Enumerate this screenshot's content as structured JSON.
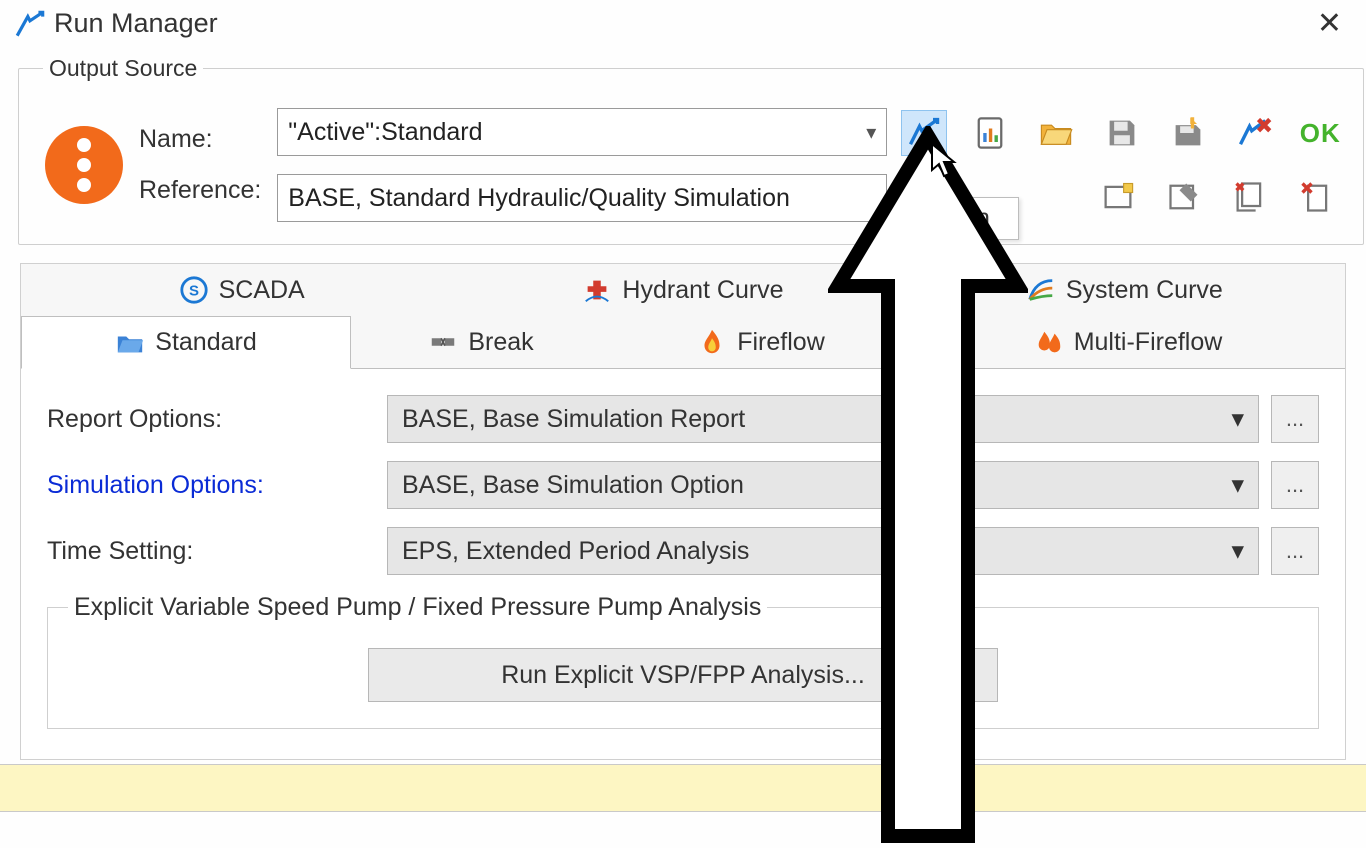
{
  "window": {
    "title": "Run Manager",
    "close_glyph": "✕"
  },
  "output_source": {
    "legend": "Output Source",
    "name_label": "Name:",
    "reference_label": "Reference:",
    "name_value": "\"Active\":Standard",
    "reference_value": "BASE, Standard Hydraulic/Quality Simulation"
  },
  "toolbar": {
    "ok_label": "OK",
    "tooltip": "Run"
  },
  "tabs": {
    "scada": "SCADA",
    "hydrant_curve": "Hydrant Curve",
    "system_curve": "System Curve",
    "standard": "Standard",
    "break": "Break",
    "fireflow": "Fireflow",
    "multi_fireflow": "Multi-Fireflow"
  },
  "standard_tab": {
    "report_options_label": "Report Options:",
    "report_options_value": "BASE, Base Simulation Report",
    "simulation_options_label": "Simulation Options:",
    "simulation_options_value": "BASE, Base Simulation Option",
    "time_setting_label": "Time Setting:",
    "time_setting_value": "EPS, Extended Period Analysis",
    "vsp_group_legend": "Explicit Variable Speed Pump / Fixed Pressure Pump Analysis",
    "vsp_button_label": "Run Explicit VSP/FPP Analysis...",
    "ellipsis": "..."
  }
}
